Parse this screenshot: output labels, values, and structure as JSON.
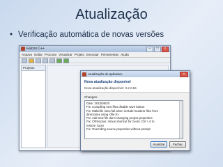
{
  "slide": {
    "title": "Atualização",
    "bullet_symbol": "•",
    "bullet_text": "Verificação automática de novas versões"
  },
  "app": {
    "title": "Falcon C++",
    "menu": [
      "Arquivo",
      "Editar",
      "Procurar",
      "Visualizar",
      "Projeto",
      "Executar",
      "Ferramentas",
      "Ajuda"
    ],
    "project_tab": "Projetos"
  },
  "dialog": {
    "title": "Atualização do aplicativo",
    "heading": "Nova atualização disponível",
    "subtext": "Nova atualização disponível: 3.2.0.56",
    "changes_label": "Changes:",
    "changes": [
      "Date: 2013/05/20",
      "Fix: Compiling new files disable save button",
      "Fix: Makefile roles fail when include headers files from",
      "directories using <file.h>",
      "Fix: Add new file don't changing project properties",
      "Fix: CR94 plus: minus shortcut for zoom: Ctrl + 0 to",
      "restore zoom",
      "Fix: Overriding source properties without prompt"
    ],
    "buttons": {
      "update": "Atualizar",
      "close": "Fechar"
    }
  }
}
